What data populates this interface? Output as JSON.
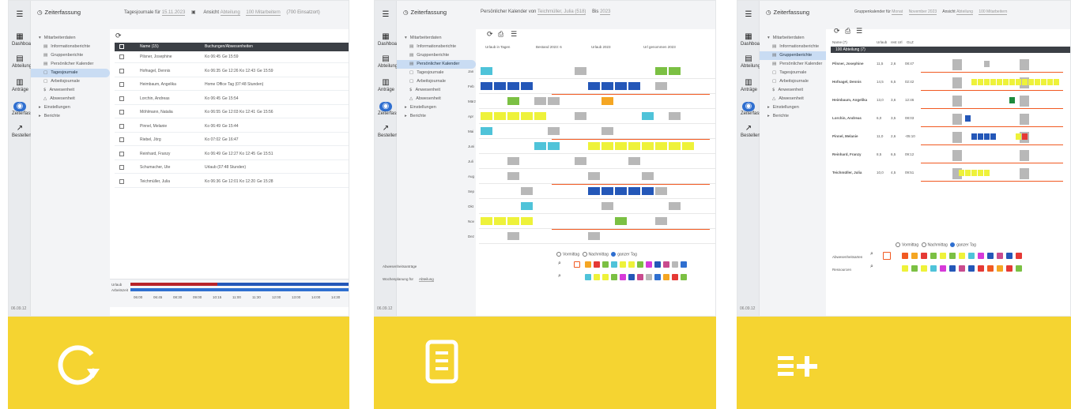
{
  "colors": {
    "accent_yellow": "#f5d431",
    "nav_selected": "#c9dcf3",
    "header_dark": "#3b3f45",
    "orange": "#f15a22",
    "blue": "#2f6fd0"
  },
  "panels": [
    {
      "icon": "refresh-icon",
      "app_title": "Zeiterfassung",
      "toolbar": [
        "Tagesjournale für",
        "15.11.2023",
        "Ansicht",
        "Abteilung",
        "100 Mitarbeitern",
        "(700 Einsatzort)"
      ],
      "rail": [
        "Dashboard",
        "Abteilung",
        "Anträge",
        "Zeiterfassung",
        "Bestellen"
      ],
      "nav": [
        "Mitarbeiterdaten",
        "Informationsberichte",
        "Gruppenberichte",
        "Persönlicher Kalender",
        "Tagesjournale",
        "Arbeitsjournale",
        "Anwesenheit",
        "Abwesenheit",
        "Einstellungen",
        "Berichte"
      ],
      "selected_nav": "Tagesjournale",
      "table_headers": [
        "Name (15)",
        "Buchungen/Abwesenheiten"
      ],
      "rows": [
        {
          "name": "Pilsner, Josephine",
          "b": [
            "Ko 06:45",
            "Ge 15:59"
          ]
        },
        {
          "name": "Hofnagel, Dennis",
          "b": [
            "Ko 06:35",
            "Ge 12:26",
            "Ko 12:43",
            "Ge 15:59"
          ]
        },
        {
          "name": "Heimbaum, Angelika",
          "b": [
            "Home Office Tag (07:48 Stunden)"
          ]
        },
        {
          "name": "Lorchin, Andreas",
          "b": [
            "Ko 06:45",
            "Ge 15:54"
          ]
        },
        {
          "name": "Möhlmann, Natalia",
          "b": [
            "Ko 06:55",
            "Ge 12:03",
            "Ko 12:41",
            "Ge 15:56"
          ]
        },
        {
          "name": "Pinnel, Melanie",
          "b": [
            "Ko 06:49",
            "Ge 15:44"
          ]
        },
        {
          "name": "Riebel, Jörg",
          "b": [
            "Ko 07:02",
            "Ge 16:47"
          ]
        },
        {
          "name": "Reinhard, Franzy",
          "b": [
            "Ko 06:49",
            "Ge 12:27",
            "Ko 12:45",
            "Ge 15:51"
          ]
        },
        {
          "name": "Schumacher, Ute",
          "b": [
            "Urlaub (07:48 Stunden)"
          ]
        },
        {
          "name": "Teichmüller, Julia",
          "b": [
            "Ko 06:36",
            "Ge 12:01",
            "Ko 12:20",
            "Ge 15:28"
          ]
        }
      ],
      "timeline": [
        "Urlaub",
        "Arbeitszeit",
        "06:00",
        "06:45",
        "08:30",
        "09:00",
        "10:15",
        "11:00",
        "11:30",
        "12:00",
        "13:00",
        "14:00",
        "14:30"
      ],
      "version": "06.09.12"
    },
    {
      "icon": "document-icon",
      "app_title": "Zeiterfassung",
      "toolbar": [
        "Persönlicher Kalender von",
        "Teichmüller, Julia (518)",
        "Bis",
        "2023"
      ],
      "rail": [
        "Dashboard",
        "Abteilung",
        "Anträge",
        "Zeiterfassung",
        "Bestellen"
      ],
      "nav": [
        "Mitarbeiterdaten",
        "Informationsberichte",
        "Gruppenberichte",
        "Persönlicher Kalender",
        "Tagesjournale",
        "Arbeitsjournale",
        "Anwesenheit",
        "Abwesenheit",
        "Einstellungen",
        "Berichte"
      ],
      "selected_nav": "Persönlicher Kalender",
      "summary": [
        "Urlaub in Tagen",
        "Bestand 2023: 6",
        "Urlaub 2023",
        "Url genommen 2023"
      ],
      "months": [
        "Jan",
        "Feb",
        "März",
        "Apr",
        "Mai",
        "Juni",
        "Juli",
        "Aug",
        "Sep",
        "Okt",
        "Nov",
        "Dez"
      ],
      "radios": [
        "Vormittag",
        "Nachmittag",
        "ganzer Tag"
      ],
      "legend_labels": [
        "Abwesenheitsanträge",
        "Wochenplanung für",
        "Abteilung"
      ],
      "version": "06.09.12"
    },
    {
      "icon": "list-add-icon",
      "app_title": "Zeiterfassung",
      "toolbar": [
        "Gruppenkalender für",
        "Monat",
        "November 2023",
        "Ansicht",
        "Abteilung",
        "100 Mitarbeitern"
      ],
      "rail": [
        "Dashboard",
        "Abteilung",
        "Anträge",
        "Zeiterfassung",
        "Bestellen"
      ],
      "nav": [
        "Mitarbeiterdaten",
        "Informationsberichte",
        "Gruppenberichte",
        "Persönlicher Kalender",
        "Tagesjournale",
        "Arbeitsjournale",
        "Anwesenheit",
        "Abwesenheit",
        "Einstellungen",
        "Berichte"
      ],
      "selected_nav": "Gruppenberichte",
      "table_headers": [
        "Name (7)",
        "Urlaub",
        "rest Url",
        "GLZ"
      ],
      "group_label": "100 Abteilung (7)",
      "rows": [
        {
          "name": "Pilsner, Josephine",
          "v": [
            "11,5",
            "2,6",
            "08:47"
          ]
        },
        {
          "name": "Hofnagel, Dennis",
          "v": [
            "14,5",
            "6,5",
            "02:42"
          ]
        },
        {
          "name": "Heimbaum, Angelika",
          "v": [
            "13,0",
            "3,6",
            "12:46"
          ]
        },
        {
          "name": "Lorchin, Andreas",
          "v": [
            "6,0",
            "3,5",
            "08:03"
          ]
        },
        {
          "name": "Pinnel, Melanie",
          "v": [
            "11,0",
            "2,6",
            "-05:10"
          ]
        },
        {
          "name": "Reinhard, Franzy",
          "v": [
            "8,5",
            "6,5",
            "09:12"
          ]
        },
        {
          "name": "Teichmüller, Julia",
          "v": [
            "10,0",
            "4,5",
            "09:51"
          ]
        }
      ],
      "radios": [
        "Vormittag",
        "Nachmittag",
        "ganzer Tag"
      ],
      "legend_labels": [
        "Abwesenheitsarten",
        "Ressourcen"
      ],
      "version": "06.09.12"
    }
  ]
}
